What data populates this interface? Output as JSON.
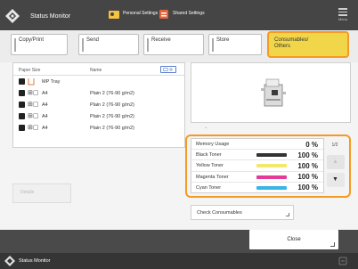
{
  "header": {
    "title": "Status Monitor",
    "personal_settings": "Personal Settings",
    "shared_settings": "Shared Settings",
    "menu_label": "Menu"
  },
  "tabs": [
    {
      "label": "Copy/Print"
    },
    {
      "label": "Send"
    },
    {
      "label": "Receive"
    },
    {
      "label": "Store"
    },
    {
      "label": "Consumables/ Others",
      "active": true
    }
  ],
  "paper": {
    "columns": {
      "size": "Paper Size",
      "name": "Name"
    },
    "rows": [
      {
        "size": "MP Tray",
        "name": ""
      },
      {
        "size": "A4",
        "name": "Plain 2 (76-90 g/m2)"
      },
      {
        "size": "A4",
        "name": "Plain 2 (76-90 g/m2)"
      },
      {
        "size": "A4",
        "name": "Plain 2 (76-90 g/m2)"
      },
      {
        "size": "A4",
        "name": "Plain 2 (76-90 g/m2)"
      }
    ],
    "details_label": "Details"
  },
  "consumables": {
    "rows": [
      {
        "name": "Memory Usage",
        "percent": "0 %",
        "color": ""
      },
      {
        "name": "Black Toner",
        "percent": "100 %",
        "color": "#333333"
      },
      {
        "name": "Yellow Toner",
        "percent": "100 %",
        "color": "#f2e86a"
      },
      {
        "name": "Magenta Toner",
        "percent": "100 %",
        "color": "#e43a9a"
      },
      {
        "name": "Cyan Toner",
        "percent": "100 %",
        "color": "#38b4e6"
      }
    ],
    "page": "1/2",
    "check_label": "Check Consumables"
  },
  "footer": {
    "close_label": "Close",
    "status_text": "Status Monitor"
  },
  "colors": {
    "accent": "#f59a23",
    "active_tab": "#f2d64a"
  }
}
